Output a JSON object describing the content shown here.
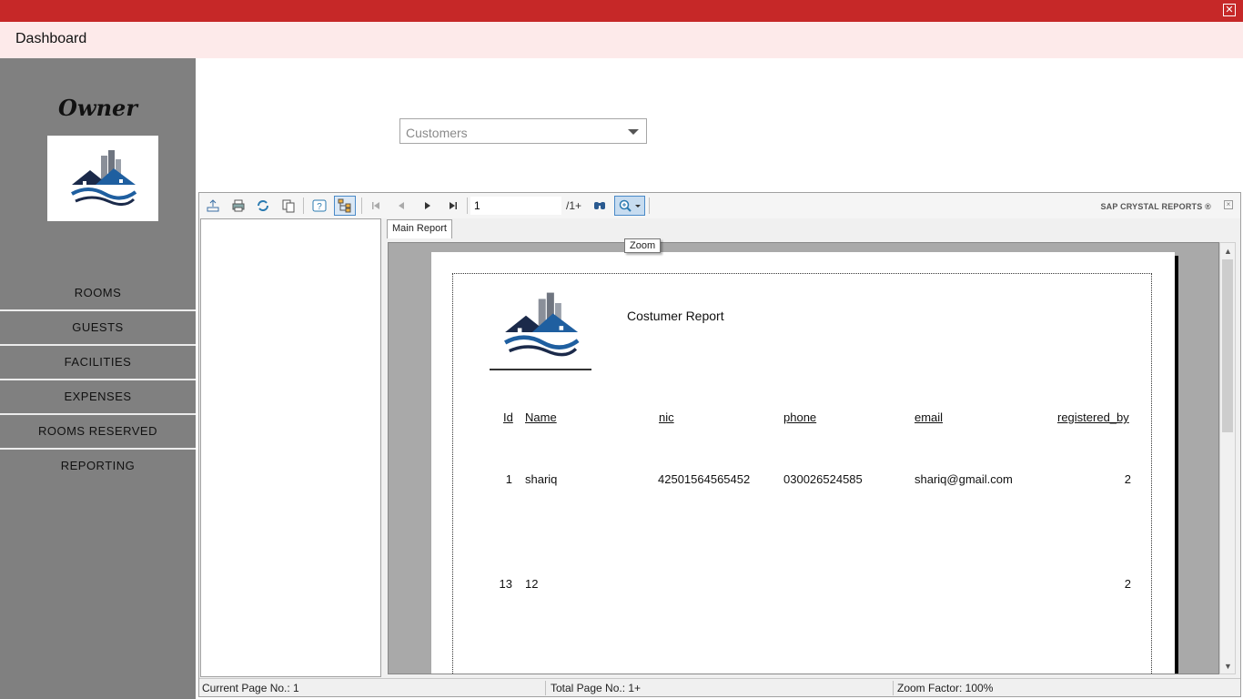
{
  "window": {
    "title": "Dashboard",
    "close_glyph": "✕"
  },
  "sidebar": {
    "owner_label": "Owner",
    "logo_icon": "house-logo-icon",
    "items": [
      {
        "label": "ROOMS"
      },
      {
        "label": "GUESTS"
      },
      {
        "label": "FACILITIES"
      },
      {
        "label": "EXPENSES"
      },
      {
        "label": "ROOMS RESERVED"
      },
      {
        "label": "REPORTING"
      }
    ]
  },
  "report_select": {
    "value": "Customers"
  },
  "viewer": {
    "toolbar": {
      "page_value": "1",
      "page_total": "/1+",
      "brand": "SAP CRYSTAL REPORTS",
      "brand_mark": "®",
      "tooltip": "Zoom"
    },
    "tab_label": "Main Report",
    "report": {
      "title": "Costumer Report",
      "headers": [
        "Id",
        "Name",
        "nic",
        "phone",
        "email",
        "registered_by"
      ],
      "rows": [
        [
          "1",
          "shariq",
          "42501564565452",
          "030026524585",
          "shariq@gmail.com",
          "2"
        ],
        [
          "13",
          "12",
          "",
          "",
          "",
          "2"
        ]
      ]
    },
    "status": {
      "current_page": "Current Page No.: 1",
      "total_page": "Total Page No.: 1+",
      "zoom_factor": "Zoom Factor: 100%"
    }
  },
  "colors": {
    "topbar": "#c62828",
    "header": "#fdeaea",
    "sidebar": "#808080",
    "accent_blue": "#1f5fa0"
  }
}
